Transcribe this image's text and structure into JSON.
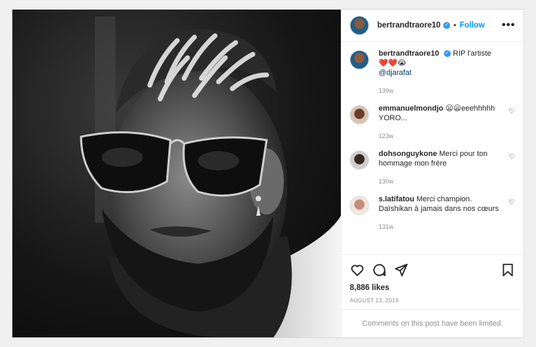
{
  "post": {
    "author": {
      "username": "bertrandtraore10",
      "verified_icon": "verified-badge-icon",
      "follow_label": "Follow",
      "separator": "•",
      "more_icon": "more-options-icon",
      "more_glyph": "•••"
    },
    "comments": [
      {
        "username": "bertrandtraore10",
        "text": "RIP l'artiste",
        "emojis": "❤️❤️😭",
        "mention": "@djarafat",
        "time": "139w",
        "verified": true
      },
      {
        "username": "emmanuelmondjo",
        "text": "😦😦eeehhhhh YORO...",
        "time": "123w"
      },
      {
        "username": "dohsonguykone",
        "text": "Merci pour ton hommage mon frère",
        "time": "130w"
      },
      {
        "username": "s.latifatou",
        "text": "Merci champion. Daïshikan à jamais dans nos cœurs",
        "time": "131w"
      }
    ],
    "actions": {
      "like_icon": "heart-icon",
      "comment_icon": "comment-icon",
      "share_icon": "share-icon",
      "save_icon": "bookmark-icon"
    },
    "likes": "8,886 likes",
    "date": "AUGUST 13, 2019",
    "comments_limited": "Comments on this post have been limited.",
    "colors": {
      "link_blue": "#0095f6",
      "muted": "#8e8e8e",
      "border": "#dbdbdb"
    }
  }
}
